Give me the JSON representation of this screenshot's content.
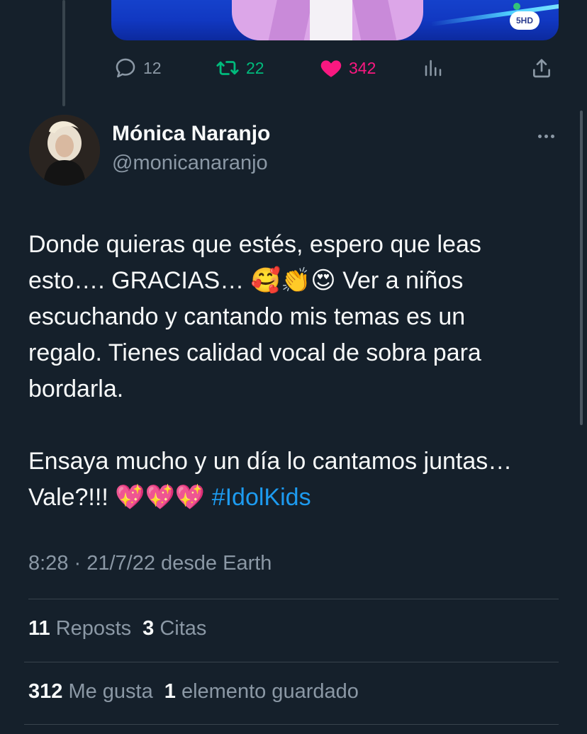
{
  "media": {
    "channel_logo": "5HD",
    "channel_dot_color": "#33c27a"
  },
  "actions": {
    "reply_count": "12",
    "repost_count": "22",
    "like_count": "342",
    "views_icon": "bar-chart-icon",
    "share_icon": "share-icon"
  },
  "author": {
    "name": "Mónica Naranjo",
    "handle": "@monicanaranjo"
  },
  "tweet": {
    "line1": "Donde quieras que estés, espero que leas",
    "line2_text": "esto…. GRACIAS… ",
    "line2_emojis": "🥰👏😍",
    "line2_rest": " Ver a niños",
    "line3": "escuchando y cantando mis temas es un",
    "line4": "regalo. Tienes calidad vocal de sobra para",
    "line5": "bordarla.",
    "line6": "Ensaya mucho y un día lo cantamos juntas…",
    "line7_text": "Vale?!!! ",
    "line7_emojis": "💖💖💖",
    "hashtag": "#IdolKids"
  },
  "timestamp": "8:28 · 21/7/22 desde Earth",
  "stats": {
    "reposts_count": "11",
    "reposts_label": "Reposts",
    "quotes_count": "3",
    "quotes_label": "Citas",
    "likes_count": "312",
    "likes_label": "Me gusta",
    "saved_count": "1",
    "saved_label": "elemento guardado"
  },
  "colors": {
    "background": "#15202b",
    "text": "#f7f9f9",
    "muted": "#8b98a5",
    "repost": "#00ba7c",
    "like": "#f91880",
    "link": "#1d9bf0"
  }
}
